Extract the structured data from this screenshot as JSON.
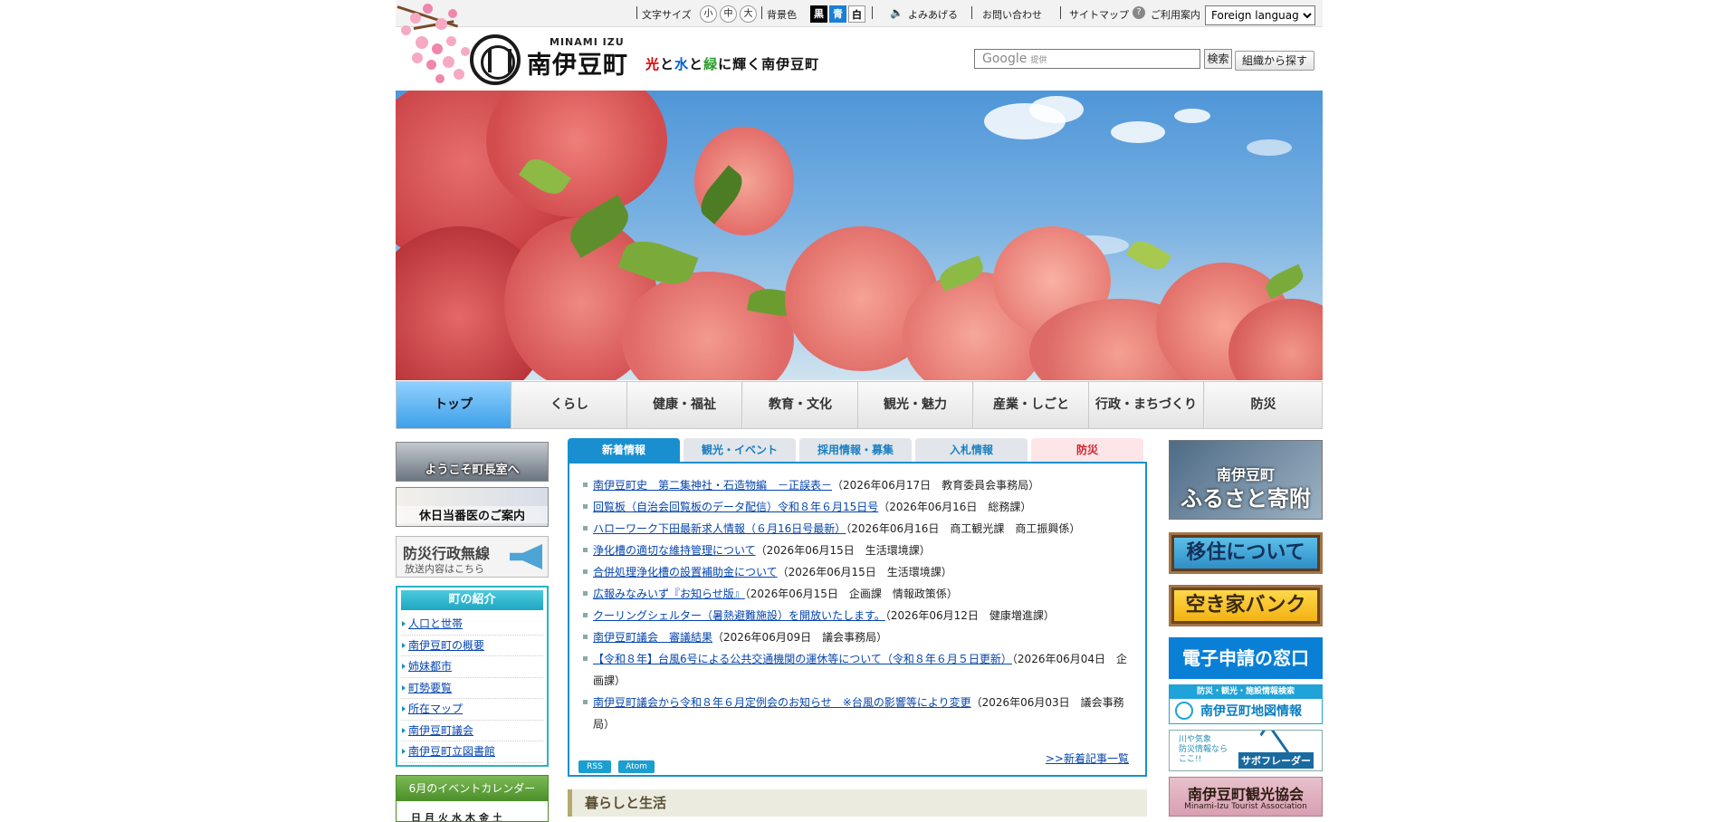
{
  "utility": {
    "font_size_label": "文字サイズ",
    "font_sizes": [
      "小",
      "中",
      "大"
    ],
    "bg_label": "背景色",
    "bg_options": [
      {
        "label": "黒",
        "bg": "#000000",
        "fg": "#ffffff"
      },
      {
        "label": "青",
        "bg": "#1a7fd6",
        "fg": "#ffffff"
      },
      {
        "label": "白",
        "bg": "#ffffff",
        "fg": "#000000"
      }
    ],
    "read_aloud": "よみあげる",
    "contact": "お問い合わせ",
    "sitemap": "サイトマップ",
    "guide": "ご利用案内",
    "language_select": "Foreign language"
  },
  "header": {
    "logo_en": "MINAMI IZU",
    "logo_jp": "南伊豆町",
    "tagline": [
      "光",
      "と",
      "水",
      "と",
      "緑",
      "に輝く南伊豆町"
    ],
    "search_google": "Google",
    "search_provided": "提供",
    "search_button": "検索",
    "org_button": "組織から探す"
  },
  "global_nav": [
    "トップ",
    "くらし",
    "健康・福祉",
    "教育・文化",
    "観光・魅力",
    "産業・しごと",
    "行政・まちづくり",
    "防災"
  ],
  "left": {
    "mayor": "ようこそ町長室へ",
    "doctor": "休日当番医のご案内",
    "bousai_title": "防災行政無線",
    "bousai_sub": "放送内容はこちら",
    "intro_title": "町の紹介",
    "intro_items": [
      "人口と世帯",
      "南伊豆町の概要",
      "姉妹都市",
      "町勢要覧",
      "所在マップ",
      "南伊豆町議会",
      "南伊豆町立図書館"
    ],
    "event_title": "6月のイベントカレンダー",
    "event_days": "日月火水木金土"
  },
  "tabs": [
    "新着情報",
    "観光・イベント",
    "採用情報・募集",
    "入札情報",
    "防災"
  ],
  "news": [
    {
      "title": "南伊豆町史　第二集神社・石造物編　－正誤表－",
      "meta": "（2026年06月17日　教育委員会事務局）"
    },
    {
      "title": "回覧板（自治会回覧板のデータ配信）令和８年６月15日号",
      "meta": "（2026年06月16日　総務課）"
    },
    {
      "title": "ハローワーク下田最新求人情報（６月16日号最新）",
      "meta": "（2026年06月16日　商工観光課　商工振興係）"
    },
    {
      "title": "浄化槽の適切な維持管理について",
      "meta": "（2026年06月15日　生活環境課）"
    },
    {
      "title": "合併処理浄化槽の設置補助金について",
      "meta": "（2026年06月15日　生活環境課）"
    },
    {
      "title": "広報みなみいず『お知らせ版』",
      "meta": "（2026年06月15日　企画課　情報政策係）"
    },
    {
      "title": "クーリングシェルター（暑熱避難施設）を開放いたします。",
      "meta": "（2026年06月12日　健康増進課）"
    },
    {
      "title": "南伊豆町議会　審議結果",
      "meta": "（2026年06月09日　議会事務局）"
    },
    {
      "title": "【令和８年】台風6号による公共交通機関の運休等について（令和８年６月５日更新）",
      "meta": "（2026年06月04日　企画課）"
    },
    {
      "title": "南伊豆町議会から令和８年６月定例会のお知らせ　※台風の影響等により変更",
      "meta": "（2026年06月03日　議会事務局）"
    }
  ],
  "feeds": [
    "RSS",
    "Atom"
  ],
  "news_more": ">>新着記事一覧",
  "section_title": "暮らしと生活",
  "right": {
    "furusato_1": "南伊豆町",
    "furusato_2": "ふるさと寄附",
    "ijuu": "移住について",
    "akiya": "空き家バンク",
    "denshi": "電子申請の窓口",
    "map_top": "防災・観光・施設情報検索",
    "map_main": "南伊豆町地図情報",
    "sabo_1": "川や気象",
    "sabo_2": "防災情報なら",
    "sabo_3": "ここ!!",
    "sabo_brand": "サボフレーダー",
    "kanko_jp": "南伊豆町観光協会",
    "kanko_en": "Minami-Izu Tourist Association"
  }
}
